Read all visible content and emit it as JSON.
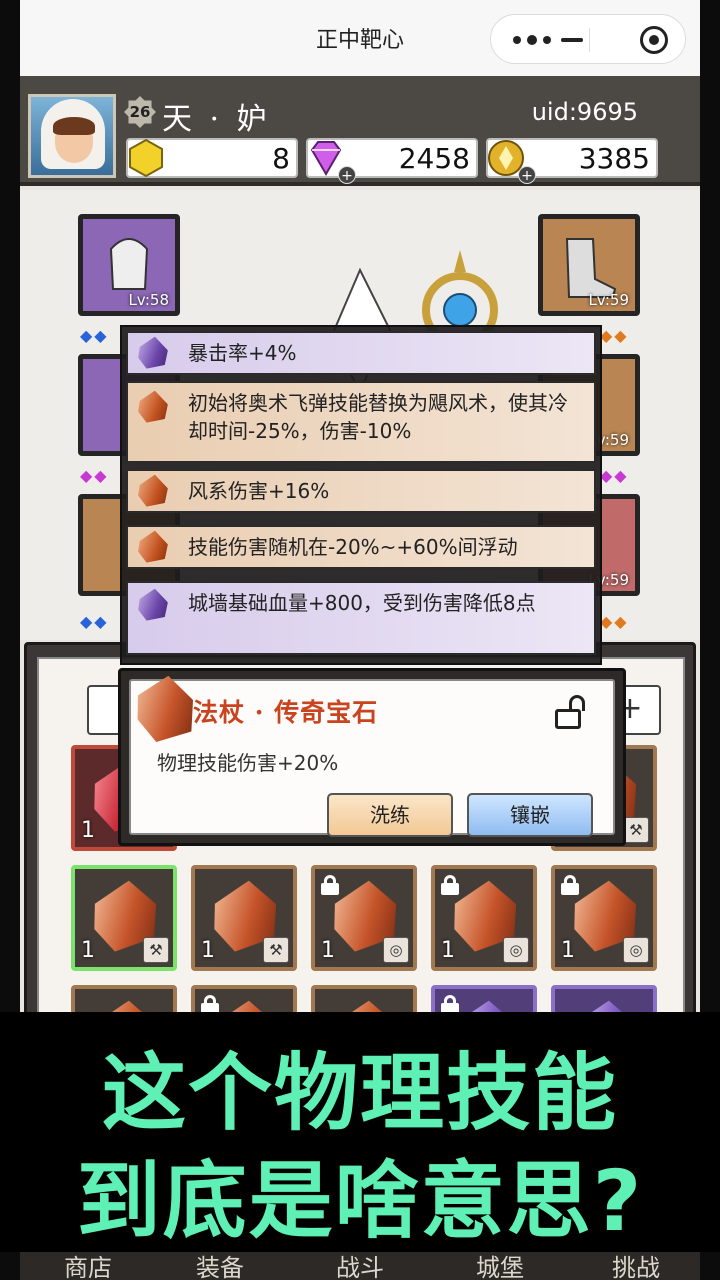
{
  "window": {
    "title": "正中靶心"
  },
  "player": {
    "level": "26",
    "name": "天 · 妒",
    "uid": "uid:9695"
  },
  "resources": [
    {
      "name": "energy",
      "icon": "yellow-hexagon-icon",
      "value": "8"
    },
    {
      "name": "diamond",
      "icon": "diamond-icon",
      "value": "2458"
    },
    {
      "name": "gold",
      "icon": "gold-coin-icon",
      "value": "3385"
    }
  ],
  "equipment": {
    "left": [
      {
        "lv": "Lv:58"
      }
    ],
    "right": [
      {
        "lv": "Lv:59"
      },
      {
        "lv": "Lv:59"
      },
      {
        "lv": "Lv:59"
      }
    ]
  },
  "tooltip": {
    "rows": [
      {
        "gem": "purple",
        "text": "暴击率+4%"
      },
      {
        "gem": "orange",
        "text": "初始将奥术飞弹技能替换为飓风术，使其冷却时间-25%，伤害-10%"
      },
      {
        "gem": "orange",
        "text": "风系伤害+16%"
      },
      {
        "gem": "orange",
        "text": "技能伤害随机在-20%~+60%间浮动"
      },
      {
        "gem": "purple",
        "text": "城墙基础血量+800，受到伤害降低8点"
      }
    ]
  },
  "gem_dialog": {
    "title": "法杖 · 传奇宝石",
    "description": "物理技能伤害+20%",
    "refine_label": "洗练",
    "inlay_label": "镶嵌"
  },
  "bag": {
    "qty": "1",
    "top_right_chip": "+"
  },
  "caption": {
    "line1": "这个物理技能",
    "line2": "到底是啥意思?"
  },
  "bottom_nav": [
    "商店",
    "装备",
    "战斗",
    "城堡",
    "挑战"
  ],
  "colors": {
    "caption": "#5ef0b4",
    "accent_orange": "#c8431e"
  }
}
